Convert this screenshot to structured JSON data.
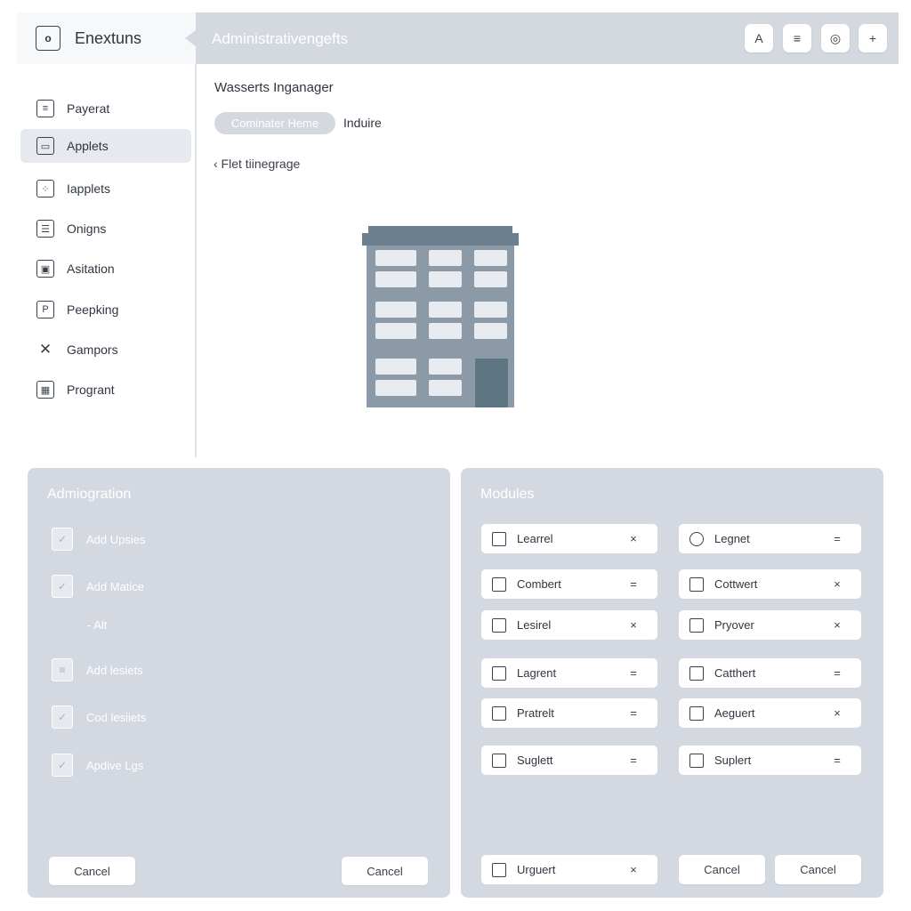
{
  "app": {
    "logo_letter": "o",
    "name": "Enextuns"
  },
  "topbar": {
    "title": "Administrativengefts",
    "buttons": [
      {
        "icon": "user-icon",
        "glyph": "A"
      },
      {
        "icon": "database-icon",
        "glyph": "≡"
      },
      {
        "icon": "target-icon",
        "glyph": "◎"
      },
      {
        "icon": "plus-icon",
        "glyph": "+"
      }
    ]
  },
  "sidebar": {
    "active_index": 1,
    "items": [
      {
        "label": "Payerat",
        "icon": "list-icon",
        "glyph": "≡"
      },
      {
        "label": "Applets",
        "icon": "monitor-icon",
        "glyph": "▭"
      },
      {
        "label": "Iapplets",
        "icon": "edit-grid-icon",
        "glyph": "⁘"
      },
      {
        "label": "Onigns",
        "icon": "checklist-icon",
        "glyph": "☰"
      },
      {
        "label": "Asitation",
        "icon": "window-icon",
        "glyph": "▣"
      },
      {
        "label": "Peepking",
        "icon": "document-icon",
        "glyph": "P"
      },
      {
        "label": "Gampors",
        "icon": "tools-icon",
        "glyph": "✕"
      },
      {
        "label": "Progrant",
        "icon": "calendar-icon",
        "glyph": "▦"
      }
    ]
  },
  "main": {
    "title": "Wasserts Inganager",
    "chip_label": "Cominater Heme",
    "chip_side_label": "Induire",
    "back_link": "‹ Flet tiinegrage"
  },
  "admin_panel": {
    "title": "Admiogration",
    "items": [
      {
        "label": "Add Upsies",
        "icon": "check-doc-icon",
        "glyph": "✓"
      },
      {
        "label": "Add Matice",
        "icon": "check-doc-icon",
        "glyph": "✓"
      },
      {
        "label": "Add lesiets",
        "icon": "text-doc-icon",
        "glyph": "≡"
      },
      {
        "label": "Cod lesiiets",
        "icon": "check-doc-icon",
        "glyph": "✓"
      },
      {
        "label": "Apdive Lgs",
        "icon": "check-doc-icon",
        "glyph": "✓"
      }
    ],
    "sub_label": "- Alt",
    "cancel_left": "Cancel",
    "cancel_right": "Cancel"
  },
  "modules_panel": {
    "title": "Modules",
    "left": [
      {
        "label": "Learrel",
        "icon": "file-icon",
        "action": "×"
      },
      {
        "label": "Combert",
        "icon": "mail-icon",
        "action": "="
      },
      {
        "label": "Lesirel",
        "icon": "printer-icon",
        "action": "×"
      },
      {
        "label": "Lagrent",
        "icon": "file-icon",
        "action": "="
      },
      {
        "label": "Pratrelt",
        "icon": "settings-doc-icon",
        "action": "="
      },
      {
        "label": "Suglett",
        "icon": "image-icon",
        "action": "="
      }
    ],
    "right": [
      {
        "label": "Legnet",
        "icon": "search-icon",
        "action": "="
      },
      {
        "label": "Cottwert",
        "icon": "mail-icon",
        "action": "×"
      },
      {
        "label": "Pryover",
        "icon": "mail-icon",
        "action": "×"
      },
      {
        "label": "Catthert",
        "icon": "mail-icon",
        "action": "="
      },
      {
        "label": "Aeguert",
        "icon": "file-icon",
        "action": "×"
      },
      {
        "label": "Suplert",
        "icon": "mail-icon",
        "action": "="
      }
    ],
    "footer_item": {
      "label": "Urguert",
      "icon": "file-icon",
      "action": "×"
    },
    "cancel_a": "Cancel",
    "cancel_b": "Cancel"
  }
}
